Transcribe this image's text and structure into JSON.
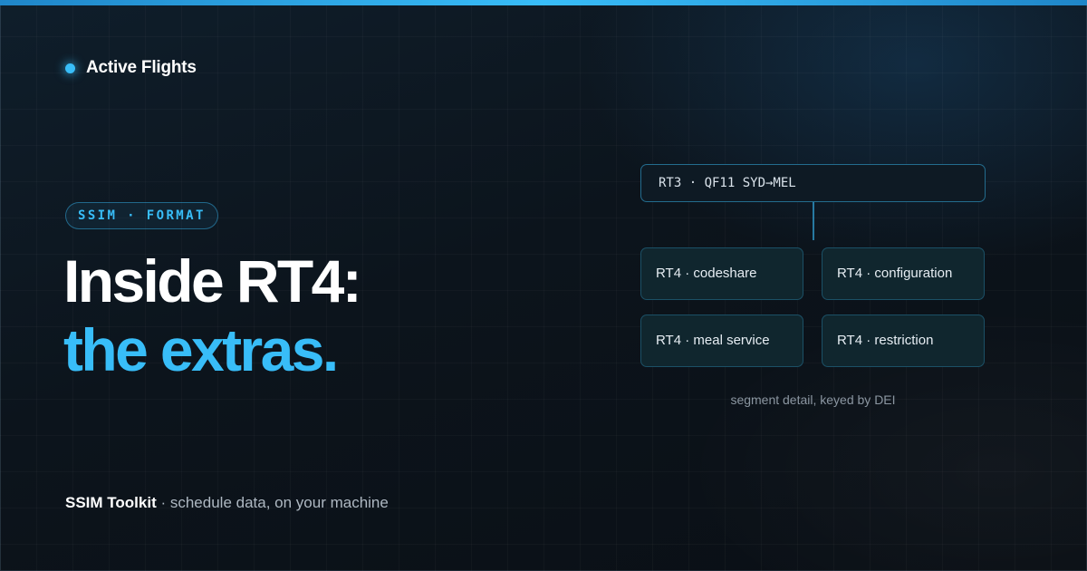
{
  "brand": {
    "name": "Active Flights"
  },
  "pill": {
    "label": "SSIM · FORMAT"
  },
  "headline": {
    "line1": "Inside RT4:",
    "line2": "the extras."
  },
  "diagram": {
    "parent": "RT3 · QF11 SYD→MEL",
    "children": [
      "RT4 · codeshare",
      "RT4 · configuration",
      "RT4 · meal service",
      "RT4 · restriction"
    ],
    "caption": "segment detail, keyed by DEI"
  },
  "footer": {
    "product": "SSIM Toolkit",
    "tagline": " · schedule data, on your machine"
  },
  "colors": {
    "accent": "#38bdf8",
    "background": "#0c141c",
    "card": "#10262e"
  }
}
